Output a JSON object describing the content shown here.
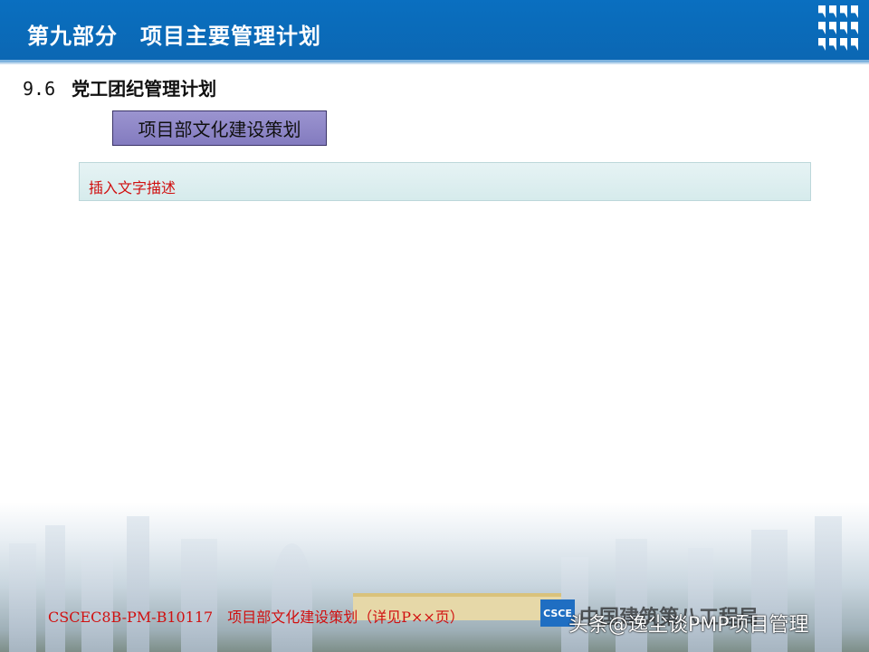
{
  "header": {
    "title": "第九部分　项目主要管理计划"
  },
  "section": {
    "number": "9.6",
    "title": "党工团纪管理计划"
  },
  "plan_box": {
    "label": "项目部文化建设策划"
  },
  "description": {
    "placeholder_text": "插入文字描述"
  },
  "footer": {
    "reference": "CSCEC8B-PM-B10117　项目部文化建设策划（详见P××页）",
    "logo_text": "CSCE",
    "company": "中国建筑第八工程局"
  },
  "watermark": "头条@逸尘谈PMP项目管理"
}
